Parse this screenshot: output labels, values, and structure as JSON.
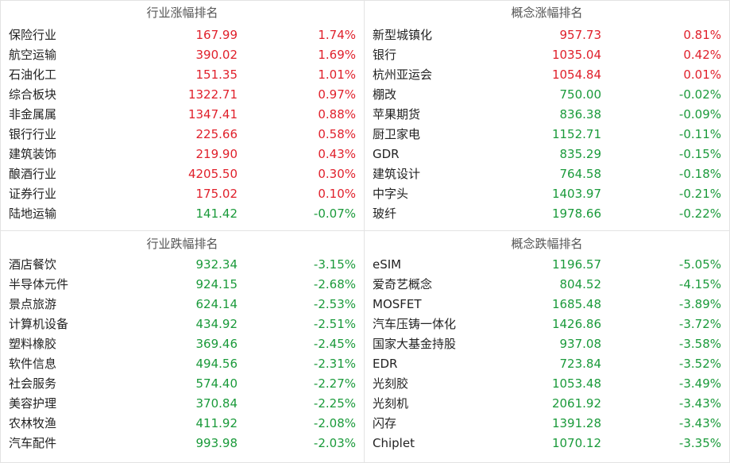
{
  "colors": {
    "up": "#e0202b",
    "down": "#1a9a3a",
    "border": "#e3e3e3",
    "title": "#555555"
  },
  "panels": {
    "industry_gainers": {
      "title": "行业涨幅排名",
      "rows": [
        {
          "name": "保险行业",
          "price": "167.99",
          "change": "1.74%",
          "dir": "up"
        },
        {
          "name": "航空运输",
          "price": "390.02",
          "change": "1.69%",
          "dir": "up"
        },
        {
          "name": "石油化工",
          "price": "151.35",
          "change": "1.01%",
          "dir": "up"
        },
        {
          "name": "综合板块",
          "price": "1322.71",
          "change": "0.97%",
          "dir": "up"
        },
        {
          "name": "非金属属",
          "price": "1347.41",
          "change": "0.88%",
          "dir": "up"
        },
        {
          "name": "银行行业",
          "price": "225.66",
          "change": "0.58%",
          "dir": "up"
        },
        {
          "name": "建筑装饰",
          "price": "219.90",
          "change": "0.43%",
          "dir": "up"
        },
        {
          "name": "酿酒行业",
          "price": "4205.50",
          "change": "0.30%",
          "dir": "up"
        },
        {
          "name": "证券行业",
          "price": "175.02",
          "change": "0.10%",
          "dir": "up"
        },
        {
          "name": "陆地运输",
          "price": "141.42",
          "change": "-0.07%",
          "dir": "down"
        }
      ]
    },
    "concept_gainers": {
      "title": "概念涨幅排名",
      "rows": [
        {
          "name": "新型城镇化",
          "price": "957.73",
          "change": "0.81%",
          "dir": "up"
        },
        {
          "name": "银行",
          "price": "1035.04",
          "change": "0.42%",
          "dir": "up"
        },
        {
          "name": "杭州亚运会",
          "price": "1054.84",
          "change": "0.01%",
          "dir": "up"
        },
        {
          "name": "棚改",
          "price": "750.00",
          "change": "-0.02%",
          "dir": "down"
        },
        {
          "name": "苹果期货",
          "price": "836.38",
          "change": "-0.09%",
          "dir": "down"
        },
        {
          "name": "厨卫家电",
          "price": "1152.71",
          "change": "-0.11%",
          "dir": "down"
        },
        {
          "name": "GDR",
          "price": "835.29",
          "change": "-0.15%",
          "dir": "down"
        },
        {
          "name": "建筑设计",
          "price": "764.58",
          "change": "-0.18%",
          "dir": "down"
        },
        {
          "name": "中字头",
          "price": "1403.97",
          "change": "-0.21%",
          "dir": "down"
        },
        {
          "name": "玻纤",
          "price": "1978.66",
          "change": "-0.22%",
          "dir": "down"
        }
      ]
    },
    "industry_losers": {
      "title": "行业跌幅排名",
      "rows": [
        {
          "name": "酒店餐饮",
          "price": "932.34",
          "change": "-3.15%",
          "dir": "down"
        },
        {
          "name": "半导体元件",
          "price": "924.15",
          "change": "-2.68%",
          "dir": "down"
        },
        {
          "name": "景点旅游",
          "price": "624.14",
          "change": "-2.53%",
          "dir": "down"
        },
        {
          "name": "计算机设备",
          "price": "434.92",
          "change": "-2.51%",
          "dir": "down"
        },
        {
          "name": "塑料橡胶",
          "price": "369.46",
          "change": "-2.45%",
          "dir": "down"
        },
        {
          "name": "软件信息",
          "price": "494.56",
          "change": "-2.31%",
          "dir": "down"
        },
        {
          "name": "社会服务",
          "price": "574.40",
          "change": "-2.27%",
          "dir": "down"
        },
        {
          "name": "美容护理",
          "price": "370.84",
          "change": "-2.25%",
          "dir": "down"
        },
        {
          "name": "农林牧渔",
          "price": "411.92",
          "change": "-2.08%",
          "dir": "down"
        },
        {
          "name": "汽车配件",
          "price": "993.98",
          "change": "-2.03%",
          "dir": "down"
        }
      ]
    },
    "concept_losers": {
      "title": "概念跌幅排名",
      "rows": [
        {
          "name": "eSIM",
          "price": "1196.57",
          "change": "-5.05%",
          "dir": "down"
        },
        {
          "name": "爱奇艺概念",
          "price": "804.52",
          "change": "-4.15%",
          "dir": "down"
        },
        {
          "name": "MOSFET",
          "price": "1685.48",
          "change": "-3.89%",
          "dir": "down"
        },
        {
          "name": "汽车压铸一体化",
          "price": "1426.86",
          "change": "-3.72%",
          "dir": "down"
        },
        {
          "name": "国家大基金持股",
          "price": "937.08",
          "change": "-3.58%",
          "dir": "down"
        },
        {
          "name": "EDR",
          "price": "723.84",
          "change": "-3.52%",
          "dir": "down"
        },
        {
          "name": "光刻胶",
          "price": "1053.48",
          "change": "-3.49%",
          "dir": "down"
        },
        {
          "name": "光刻机",
          "price": "2061.92",
          "change": "-3.43%",
          "dir": "down"
        },
        {
          "name": "闪存",
          "price": "1391.28",
          "change": "-3.43%",
          "dir": "down"
        },
        {
          "name": "Chiplet",
          "price": "1070.12",
          "change": "-3.35%",
          "dir": "down"
        }
      ]
    }
  }
}
